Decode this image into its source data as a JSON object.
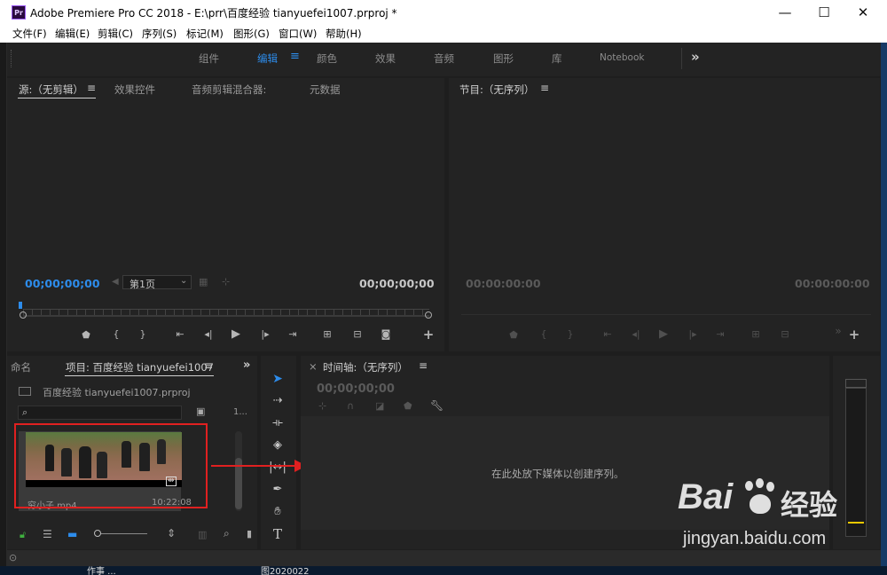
{
  "window": {
    "app_icon": "Pr",
    "title": "Adobe Premiere Pro CC 2018 - E:\\prr\\百度经验 tianyuefei1007.prproj *",
    "minimize": "—",
    "maximize": "☐",
    "close": "✕"
  },
  "menu": [
    "文件(F)",
    "编辑(E)",
    "剪辑(C)",
    "序列(S)",
    "标记(M)",
    "图形(G)",
    "窗口(W)",
    "帮助(H)"
  ],
  "workspaces": {
    "items": [
      "组件",
      "编辑",
      "颜色",
      "效果",
      "音频",
      "图形",
      "库",
      "Notebook"
    ],
    "active": "编辑",
    "menu_glyph": "≡",
    "overflow": "»"
  },
  "source_panel": {
    "tabs": [
      "源:（无剪辑）",
      "效果控件",
      "音频剪辑混合器:",
      "元数据"
    ],
    "tab_menu": "≡",
    "timecode_left": "00;00;00;00",
    "page_select": "第1页",
    "timecode_right": "00;00;00;00"
  },
  "program_panel": {
    "tab": "节目:（无序列）",
    "tab_menu": "≡",
    "timecode_left": "00:00:00:00",
    "timecode_right": "00:00:00:00"
  },
  "project_panel": {
    "tab_prev": "命名",
    "tab": "项目: 百度经验 tianyuefei1007",
    "tab_menu": "≡",
    "project_file": "百度经验 tianyuefei1007.prproj",
    "item_count": "1...",
    "clip": {
      "name": "穷小子.mp4",
      "duration": "10:22:08"
    }
  },
  "timeline_panel": {
    "close": "×",
    "tab": "时间轴:（无序列）",
    "tab_menu": "≡",
    "timecode": "00;00;00;00",
    "empty_message": "在此处放下媒体以创建序列。"
  },
  "taskbar_bits": [
    "作事 ...",
    "图2020022"
  ],
  "watermark": {
    "brand": "Bai",
    "brand2": "经验",
    "url": "jingyan.baidu.com"
  },
  "colors": {
    "accent_blue": "#2d8ceb",
    "highlight_red": "#e02020",
    "panel_bg": "#232323",
    "app_bg": "#1e1e1e"
  }
}
